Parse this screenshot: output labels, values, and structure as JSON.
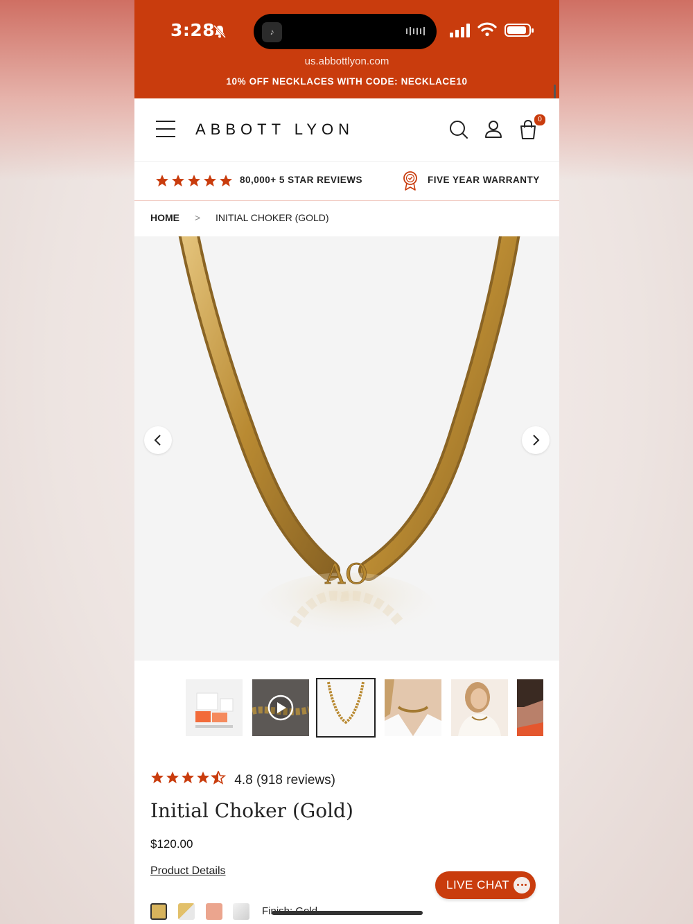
{
  "status_bar": {
    "time": "3:28"
  },
  "browser": {
    "url": "us.abbottlyon.com"
  },
  "promo_banner": {
    "text": "10% OFF NECKLACES WITH CODE: NECKLACE10"
  },
  "header": {
    "logo": "ABBOTT LYON",
    "cart_count": "0"
  },
  "trust_bar": {
    "reviews_text": "80,000+ 5 STAR REVIEWS",
    "warranty_text": "FIVE YEAR WARRANTY"
  },
  "breadcrumb": {
    "home": "HOME",
    "current": "INITIAL CHOKER (GOLD)"
  },
  "gallery": {
    "pendant_text": "AO",
    "active_thumb_index": 2,
    "thumb_count": 6
  },
  "product": {
    "rating_text": "4.8 (918 reviews)",
    "rating_value": 4.5,
    "title": "Initial Choker (Gold)",
    "price": "$120.00",
    "details_link": "Product Details",
    "finish_label": "Finish: Gold"
  },
  "live_chat": {
    "label": "LIVE CHAT"
  },
  "colors": {
    "brand": "#c93c0d",
    "star": "#c93c0d",
    "gold": "#c9a24a"
  }
}
